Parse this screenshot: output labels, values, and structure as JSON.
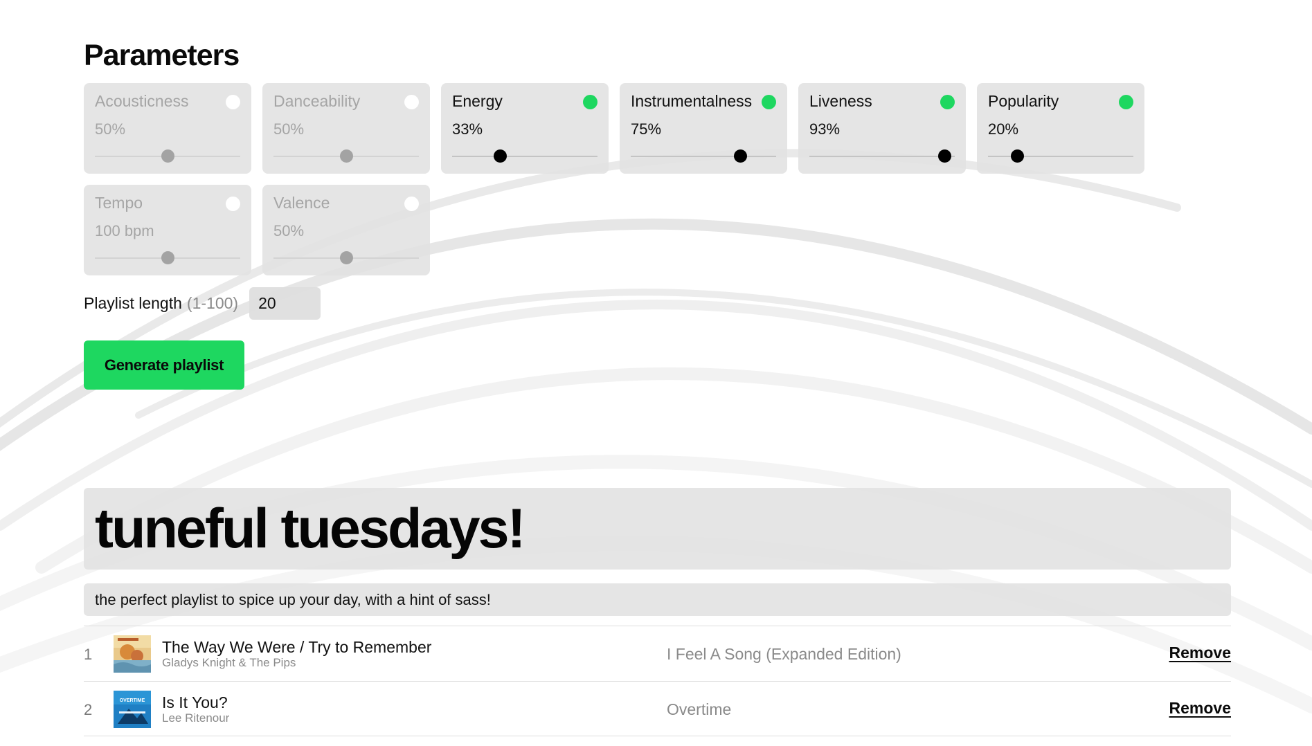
{
  "parameters": {
    "heading": "Parameters",
    "items": [
      {
        "name": "Acousticness",
        "value": "50%",
        "enabled": false,
        "level": 0.5
      },
      {
        "name": "Danceability",
        "value": "50%",
        "enabled": false,
        "level": 0.5
      },
      {
        "name": "Energy",
        "value": "33%",
        "enabled": true,
        "level": 0.33
      },
      {
        "name": "Instrumentalness",
        "value": "75%",
        "enabled": true,
        "level": 0.75
      },
      {
        "name": "Liveness",
        "value": "93%",
        "enabled": true,
        "level": 0.93
      },
      {
        "name": "Popularity",
        "value": "20%",
        "enabled": true,
        "level": 0.2
      },
      {
        "name": "Tempo",
        "value": "100 bpm",
        "enabled": false,
        "level": 0.5
      },
      {
        "name": "Valence",
        "value": "50%",
        "enabled": false,
        "level": 0.5
      }
    ]
  },
  "playlist_length": {
    "label": "Playlist length",
    "hint": "(1-100)",
    "value": "20"
  },
  "generate_button": "Generate playlist",
  "playlist": {
    "title": "tuneful tuesdays!",
    "description": "the perfect playlist to spice up your day, with a hint of sass!",
    "tracks": [
      {
        "number": "1",
        "title": "The Way We Were / Try to Remember",
        "artist": "Gladys Knight & The Pips",
        "album": "I Feel A Song (Expanded Edition)",
        "remove_label": "Remove"
      },
      {
        "number": "2",
        "title": "Is It You?",
        "artist": "Lee Ritenour",
        "album": "Overtime",
        "remove_label": "Remove",
        "art_text": "OVERTIME"
      }
    ]
  },
  "colors": {
    "accent_green": "#1ed760",
    "card_bg": "#e1e1e1",
    "text_muted": "#8a8a8a"
  }
}
